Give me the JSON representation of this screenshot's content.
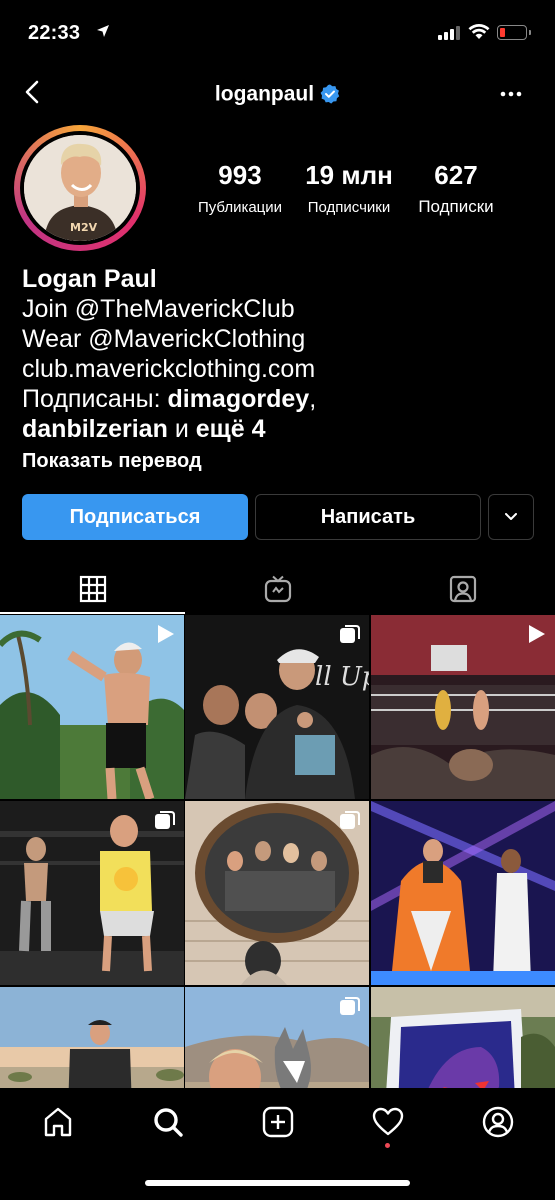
{
  "status_bar": {
    "time": "22:33"
  },
  "header": {
    "username": "loganpaul"
  },
  "profile": {
    "stats": [
      {
        "value": "993",
        "label": "Публикации"
      },
      {
        "value": "19 млн",
        "label": "Подписчики"
      },
      {
        "value": "627",
        "label": "Подписки"
      }
    ],
    "full_name": "Logan Paul",
    "bio_line_1": "Join @TheMaverickClub",
    "bio_line_2": "Wear @MaverickClothing",
    "link": "club.maverickclothing.com",
    "followed_by_prefix": "Подписаны: ",
    "followed_by_user_1": "dimagordey",
    "followed_by_sep": ",",
    "followed_by_user_2": "danbilzerian",
    "followed_by_and": " и ",
    "followed_by_more": "ещё 4",
    "show_translation": "Показать перевод"
  },
  "actions": {
    "follow_label": "Подписаться",
    "message_label": "Написать"
  },
  "tabs": [
    {
      "icon": "grid-icon",
      "selected": true
    },
    {
      "icon": "igtv-icon",
      "selected": false
    },
    {
      "icon": "tagged-icon",
      "selected": false
    }
  ],
  "posts": [
    {
      "type": "video"
    },
    {
      "type": "carousel"
    },
    {
      "type": "video"
    },
    {
      "type": "carousel"
    },
    {
      "type": "carousel"
    },
    {
      "type": "photo"
    },
    {
      "type": "photo"
    },
    {
      "type": "carousel"
    },
    {
      "type": "photo"
    }
  ],
  "bottom_nav": [
    "home-icon",
    "search-icon",
    "new-post-icon",
    "activity-icon",
    "profile-icon"
  ],
  "colors": {
    "accent": "#3897f0",
    "notification": "#ed4956",
    "background": "#000000"
  }
}
